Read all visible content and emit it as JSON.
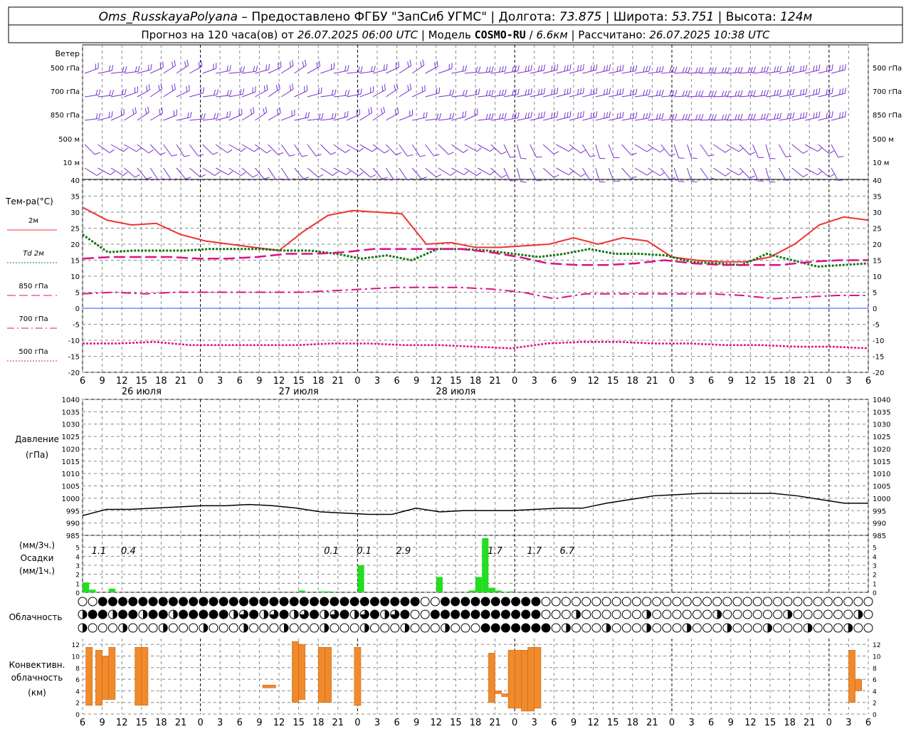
{
  "header": {
    "line1": [
      {
        "text": "Oms_RusskayaPolyana",
        "italic": true
      },
      {
        "text": " – Предоставлено ФГБУ \"ЗапСиб УГМС\" | Долгота: ",
        "italic": false
      },
      {
        "text": "73.875",
        "italic": true
      },
      {
        "text": " | Широта: ",
        "italic": false
      },
      {
        "text": "53.751",
        "italic": true
      },
      {
        "text": " | Высота: ",
        "italic": false
      },
      {
        "text": "124м",
        "italic": true
      }
    ],
    "line2": [
      {
        "text": "Прогноз на 120 часа(ов) от ",
        "italic": false
      },
      {
        "text": "26.07.2025 06:00 UTC",
        "italic": true
      },
      {
        "text": "  | Модель ",
        "italic": false
      },
      {
        "text": "COSMO-RU",
        "italic": false,
        "bold": true
      },
      {
        "text": " / ",
        "italic": false
      },
      {
        "text": "6.6км",
        "italic": true
      },
      {
        "text": " | Рассчитано: ",
        "italic": false
      },
      {
        "text": "26.07.2025 10:38 UTC",
        "italic": true
      }
    ]
  },
  "wind": {
    "title": "Ветер",
    "levels": [
      "500 гПа",
      "700 гПа",
      "850 гПа",
      "500 м",
      "10  м"
    ],
    "color": "#7a2fd0"
  },
  "temperature": {
    "title": "Тем-ра(°С)",
    "legend": [
      {
        "label": "2м",
        "color": "#ee3333",
        "style": "solid"
      },
      {
        "label": "Td  2м",
        "color": "#117711",
        "style": "dotted"
      },
      {
        "label": "850 гПа",
        "color": "#dd1188",
        "style": "dashed"
      },
      {
        "label": "700 гПа",
        "color": "#dd1188",
        "style": "dashdot"
      },
      {
        "label": "500 гПа",
        "color": "#dd1188",
        "style": "dotted"
      }
    ],
    "ticks": [
      "40",
      "35",
      "30",
      "25",
      "20",
      "15",
      "10",
      "5",
      "0",
      "-5",
      "-10",
      "-15",
      "-20"
    ]
  },
  "pressure": {
    "title": "Давление",
    "unit": "(гПа)",
    "ticks": [
      "1040",
      "1035",
      "1030",
      "1025",
      "1020",
      "1015",
      "1010",
      "1005",
      "1000",
      "995",
      "990",
      "985"
    ]
  },
  "precip": {
    "label1": "(мм/3ч.)",
    "label2": "Осадки",
    "label3": "(мм/1ч.)",
    "ticks": [
      "5",
      "4",
      "3",
      "2",
      "1",
      "0"
    ],
    "annotations": [
      "1.1",
      "0.4",
      "0.1",
      "0.1",
      "2.9",
      "1.7",
      "1.7",
      "6.7"
    ]
  },
  "clouds": {
    "title": "Облачность"
  },
  "convective": {
    "title1": "Конвективн.",
    "title2": "облачность",
    "title3": "(км)",
    "ticks": [
      "12",
      "10",
      "8",
      "6",
      "4",
      "2",
      "0"
    ]
  },
  "time_axis": {
    "hours": [
      "6",
      "9",
      "12",
      "15",
      "18",
      "21",
      "0",
      "3",
      "6",
      "9",
      "12",
      "15",
      "18",
      "21",
      "0",
      "3",
      "6",
      "9",
      "12",
      "15",
      "18",
      "21",
      "0",
      "3",
      "6",
      "9",
      "12"
    ],
    "days": [
      "26 июля",
      "27 июля",
      "28 июля"
    ]
  },
  "chart_data": [
    {
      "type": "line",
      "title": "Тем-ра(°С)",
      "x_hours_from_start": [
        0,
        3,
        6,
        9,
        12,
        15,
        18,
        21,
        24,
        27,
        30,
        33,
        36,
        39,
        42,
        45,
        48,
        51,
        54,
        57,
        60,
        63,
        66,
        69,
        72,
        75,
        78
      ],
      "ylim": [
        -20,
        40
      ],
      "series": [
        {
          "name": "2м",
          "values": [
            31.5,
            27.5,
            26,
            26.5,
            23,
            21,
            20,
            19,
            18,
            24,
            29,
            30.5,
            30,
            29.5,
            20,
            20.5,
            19,
            19,
            19.5,
            20,
            22,
            20,
            22,
            21,
            16,
            15,
            14.5,
            14.5,
            16,
            20,
            26,
            28.5,
            27.5
          ]
        },
        {
          "name": "Td  2м",
          "values": [
            23,
            17.5,
            18,
            18,
            18,
            18.5,
            18.5,
            18.5,
            18,
            18,
            17,
            15.5,
            16.5,
            15,
            18.5,
            18.5,
            18,
            17,
            16,
            17,
            18.5,
            17,
            17,
            16.5,
            14.5,
            14,
            13.5,
            17,
            15,
            13,
            13.5,
            14
          ]
        },
        {
          "name": "850 гПа",
          "values": [
            15.5,
            16,
            16,
            16,
            15.5,
            15.5,
            16,
            17,
            17,
            17.5,
            18.5,
            18.5,
            18.5,
            18.5,
            17.5,
            16,
            14,
            13.5,
            13.5,
            14,
            15,
            14,
            13.5,
            13.5,
            13.5,
            14.5,
            15,
            15
          ]
        },
        {
          "name": "700 гПа",
          "values": [
            4.5,
            5,
            4.5,
            5,
            5,
            5,
            5,
            5,
            5.5,
            6,
            6.5,
            6.5,
            6.5,
            6,
            5,
            3,
            4.5,
            4.5,
            4.5,
            4.5,
            4.5,
            4,
            3,
            3.5,
            4,
            4
          ]
        },
        {
          "name": "500 гПа",
          "values": [
            -11,
            -11,
            -10.5,
            -11.5,
            -11.5,
            -11.5,
            -11.5,
            -11,
            -11,
            -11.5,
            -11.5,
            -12,
            -12.5,
            -11,
            -10.5,
            -10.5,
            -11,
            -11,
            -11.5,
            -11.5,
            -12,
            -12,
            -12.5
          ]
        }
      ]
    },
    {
      "type": "line",
      "title": "Давление",
      "x_hours_from_start": [
        0,
        3,
        6,
        9,
        12,
        15,
        18,
        21,
        24,
        27,
        30,
        33,
        36,
        39,
        42,
        45,
        48,
        51,
        54,
        57,
        60,
        63,
        66,
        69,
        72,
        75,
        78,
        81,
        84,
        87,
        90,
        93,
        96,
        99,
        102,
        105,
        108,
        111,
        114,
        117,
        120
      ],
      "ylim": [
        985,
        1040
      ],
      "series": [
        {
          "name": "P",
          "values": [
            993,
            995.5,
            995.5,
            996,
            996.5,
            997,
            997,
            997.5,
            997,
            996,
            994.5,
            994,
            993.5,
            993.5,
            996,
            994.5,
            995,
            995,
            995,
            995.5,
            996,
            996,
            998,
            999.5,
            1001,
            1001.5,
            1002,
            1002,
            1002,
            1002,
            1001,
            999.5,
            998,
            998
          ]
        }
      ]
    },
    {
      "type": "bar",
      "title": "Осадки",
      "x_hours_from_start": [
        0,
        1,
        4,
        33,
        36,
        37,
        42,
        54,
        59,
        60,
        61,
        62,
        63,
        65
      ],
      "ylim": [
        0,
        6
      ],
      "series": [
        {
          "name": "mm/1h",
          "values": [
            1.1,
            0.3,
            0.4,
            0.2,
            0.1,
            0.1,
            3.0,
            1.7,
            0.2,
            1.7,
            6,
            0.5,
            0.2,
            0.1
          ]
        }
      ]
    },
    {
      "type": "bar",
      "title": "Конвективн. облачность (км)",
      "ylim": [
        0,
        13
      ],
      "series": [
        {
          "name": "base-top",
          "intervals": [
            [
              0.5,
              1.5,
              1.5,
              11.5
            ],
            [
              2,
              3,
              1.5,
              11
            ],
            [
              3,
              4,
              2.5,
              10
            ],
            [
              4,
              5,
              2.5,
              11.5
            ],
            [
              8,
              9,
              1.5,
              11.5
            ],
            [
              9,
              10,
              1.5,
              11.5
            ],
            [
              27.5,
              29.5,
              4.5,
              5
            ],
            [
              32,
              33,
              2,
              12.5
            ],
            [
              33,
              34,
              2.5,
              12
            ],
            [
              36,
              37,
              2,
              11.5
            ],
            [
              37,
              38,
              2,
              11.5
            ],
            [
              41.5,
              42.5,
              1.5,
              11.5
            ],
            [
              62,
              63,
              2,
              10.5
            ],
            [
              63,
              64,
              3.5,
              4
            ],
            [
              64,
              65,
              3,
              3.5
            ],
            [
              65,
              66,
              1,
              11
            ],
            [
              66,
              67,
              1,
              11
            ],
            [
              67,
              68,
              0.5,
              11
            ],
            [
              68,
              69,
              0.5,
              11.5
            ],
            [
              69,
              70,
              1,
              11.5
            ],
            [
              117,
              118,
              2,
              11
            ],
            [
              118,
              119,
              4,
              6
            ]
          ]
        }
      ]
    }
  ]
}
